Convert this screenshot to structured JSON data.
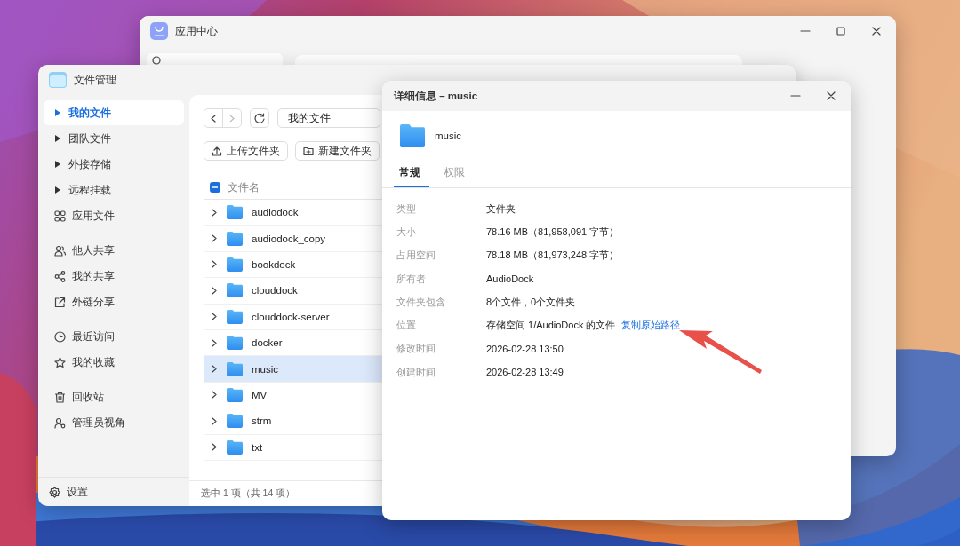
{
  "app_center": {
    "title": "应用中心"
  },
  "file_manager": {
    "title": "文件管理",
    "sidebar": {
      "groups": [
        [
          {
            "label": "我的文件",
            "kind": "tree",
            "selected": true
          },
          {
            "label": "团队文件",
            "kind": "tree",
            "selected": false
          },
          {
            "label": "外接存储",
            "kind": "tree",
            "selected": false
          },
          {
            "label": "远程挂载",
            "kind": "tree",
            "selected": false
          },
          {
            "label": "应用文件",
            "kind": "link",
            "selected": false
          }
        ],
        [
          {
            "label": "他人共享",
            "kind": "link",
            "selected": false
          },
          {
            "label": "我的共享",
            "kind": "link",
            "selected": false
          },
          {
            "label": "外链分享",
            "kind": "link",
            "selected": false
          }
        ],
        [
          {
            "label": "最近访问",
            "kind": "link",
            "selected": false
          },
          {
            "label": "我的收藏",
            "kind": "link",
            "selected": false
          }
        ],
        [
          {
            "label": "回收站",
            "kind": "link",
            "selected": false
          },
          {
            "label": "管理员视角",
            "kind": "link",
            "selected": false
          }
        ]
      ],
      "footer": "设置"
    },
    "toolbar": {
      "path": "我的文件",
      "buttons": [
        "上传文件夹",
        "新建文件夹"
      ]
    },
    "table": {
      "columns": [
        "文件名"
      ],
      "select_all_indeterminate": true,
      "rows": [
        {
          "name": "audiodock",
          "selected": false
        },
        {
          "name": "audiodock_copy",
          "selected": false
        },
        {
          "name": "bookdock",
          "selected": false
        },
        {
          "name": "clouddock",
          "selected": false
        },
        {
          "name": "clouddock-server",
          "selected": false
        },
        {
          "name": "docker",
          "selected": false
        },
        {
          "name": "music",
          "selected": true
        },
        {
          "name": "MV",
          "selected": false
        },
        {
          "name": "strm",
          "selected": false
        },
        {
          "name": "txt",
          "selected": false
        }
      ]
    },
    "status_bar": "选中 1 项（共 14 项）"
  },
  "details": {
    "title": "详细信息 – music",
    "name": "music",
    "tabs": [
      {
        "label": "常规",
        "selected": true
      },
      {
        "label": "权限",
        "selected": false
      }
    ],
    "properties": [
      {
        "label": "类型",
        "value": "文件夹"
      },
      {
        "label": "大小",
        "value": "78.16 MB（81,958,091 字节）"
      },
      {
        "label": "占用空间",
        "value": "78.18 MB（81,973,248 字节）"
      },
      {
        "label": "所有者",
        "value": "AudioDock"
      },
      {
        "label": "文件夹包含",
        "value": "8个文件，0个文件夹"
      },
      {
        "label": "位置",
        "value": "存储空间 1/AudioDock 的文件",
        "link": "复制原始路径"
      },
      {
        "label": "修改时间",
        "value": "2026-02-28 13:50"
      },
      {
        "label": "创建时间",
        "value": "2026-02-28 13:49"
      }
    ]
  }
}
